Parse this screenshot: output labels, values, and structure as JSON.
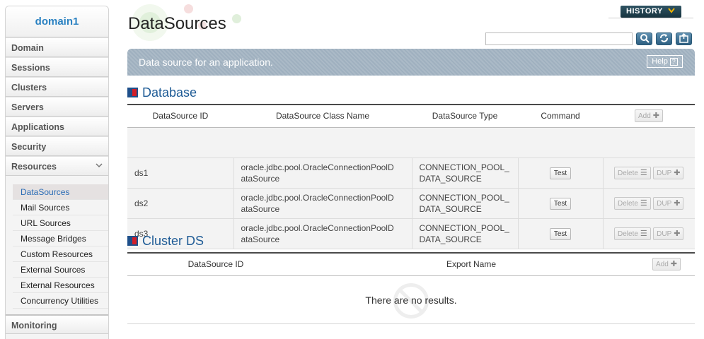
{
  "sidebar": {
    "domain": "domain1",
    "items": [
      {
        "label": "Domain"
      },
      {
        "label": "Sessions"
      },
      {
        "label": "Clusters"
      },
      {
        "label": "Servers"
      },
      {
        "label": "Applications"
      },
      {
        "label": "Security"
      },
      {
        "label": "Resources",
        "chevron": "chevron-down-icon"
      }
    ],
    "subitems": [
      {
        "label": "DataSources",
        "active": true
      },
      {
        "label": "Mail Sources"
      },
      {
        "label": "URL Sources"
      },
      {
        "label": "Message Bridges"
      },
      {
        "label": "Custom Resources"
      },
      {
        "label": "External Sources"
      },
      {
        "label": "External Resources"
      },
      {
        "label": "Concurrency Utilities"
      }
    ],
    "monitoring": "Monitoring"
  },
  "header": {
    "title": "DataSources",
    "history": "HISTORY",
    "search_value": "",
    "tools": [
      "search-icon",
      "refresh-icon",
      "export-icon"
    ]
  },
  "banner": {
    "text": "Data source for an application.",
    "help": "Help",
    "help_mark": "?"
  },
  "database": {
    "title": "Database",
    "columns": [
      "DataSource ID",
      "DataSource Class Name",
      "DataSource Type",
      "Command"
    ],
    "add": "Add",
    "rows": [
      {
        "id": "ds1",
        "class_line1": "oracle.jdbc.pool.OracleConnectionPoolD",
        "class_line2": "ataSource",
        "type_line1": "CONNECTION_POOL_",
        "type_line2": "DATA_SOURCE",
        "test": "Test",
        "delete": "Delete",
        "dup": "DUP"
      },
      {
        "id": "ds2",
        "class_line1": "oracle.jdbc.pool.OracleConnectionPoolD",
        "class_line2": "ataSource",
        "type_line1": "CONNECTION_POOL_",
        "type_line2": "DATA_SOURCE",
        "test": "Test",
        "delete": "Delete",
        "dup": "DUP"
      },
      {
        "id": "ds3",
        "class_line1": "oracle.jdbc.pool.OracleConnectionPoolD",
        "class_line2": "ataSource",
        "type_line1": "CONNECTION_POOL_",
        "type_line2": "DATA_SOURCE",
        "test": "Test",
        "delete": "Delete",
        "dup": "DUP"
      }
    ]
  },
  "cluster_ds": {
    "title": "Cluster DS",
    "columns": [
      "DataSource ID",
      "Export Name"
    ],
    "add": "Add",
    "empty": "There are no results."
  },
  "colors": {
    "accent": "#2b82c2",
    "section_title": "#1f5c96",
    "banner": "#9fb0bf",
    "history_bg": "#17333f"
  }
}
